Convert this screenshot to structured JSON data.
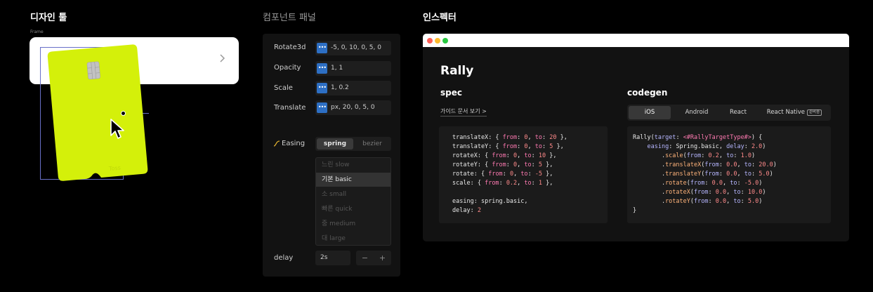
{
  "sections": {
    "design_tool": "디자인 툴",
    "component_panel": "컴포넌트 패널",
    "inspector": "인스펙터"
  },
  "design": {
    "frame_label": "Frame",
    "card_brand": "Toss"
  },
  "panel": {
    "rows": [
      {
        "label": "Rotate3d",
        "value": "-5, 0, 10, 0, 5, 0"
      },
      {
        "label": "Opacity",
        "value": "1, 1"
      },
      {
        "label": "Scale",
        "value": "1, 0.2"
      },
      {
        "label": "Translate",
        "value": "px, 20, 0, 5, 0"
      }
    ],
    "badge_glyph": "•••",
    "easing_label": "Easing",
    "easing_options": [
      "spring",
      "bezier"
    ],
    "easing_selected": "spring",
    "presets": [
      "느린 slow",
      "기본 basic",
      "소 small",
      "빠른 quick",
      "중 medium",
      "대 large"
    ],
    "preset_selected": "기본 basic",
    "delay_label": "delay",
    "delay_value": "2s",
    "minus": "−",
    "plus": "+"
  },
  "inspector": {
    "title": "Rally",
    "spec_heading": "spec",
    "codegen_heading": "codegen",
    "guide_link": "가이드 문서 보기 >",
    "tabs": [
      "iOS",
      "Android",
      "React",
      "React Native"
    ],
    "active_tab": "iOS",
    "react_native_badge": "준비중",
    "spec_code": [
      "translateX: { from: 0, to: 20 },",
      "translateY: { from: 0, to: 5 },",
      "rotateX: { from: 0, to: 10 },",
      "rotateY: { from: 0, to: 5 },",
      "rotate: { from: 0, to: -5 },",
      "scale: { from: 0.2, to: 1 },",
      "",
      "easing: spring.basic,",
      "delay: 2"
    ],
    "codegen_code": [
      "Rally(target: <#RallyTargetType#>) {",
      "    easing: Spring.basic, delay: 2.0)",
      "        .scale(from: 0.2, to: 1.0)",
      "        .translateX(from: 0.0, to: 20.0)",
      "        .translateY(from: 0.0, to: 5.0)",
      "        .rotate(from: 0.0, to: -5.0)",
      "        .rotateX(from: 0.0, to: 10.0)",
      "        .rotateY(from: 0.0, to: 5.0)",
      "}"
    ]
  },
  "colors": {
    "card": "#d4f00a",
    "badge": "#2d6fc4",
    "selection": "#6870c8",
    "dot_red": "#ff5f57",
    "dot_yellow": "#febc2e",
    "dot_green": "#28c840"
  }
}
